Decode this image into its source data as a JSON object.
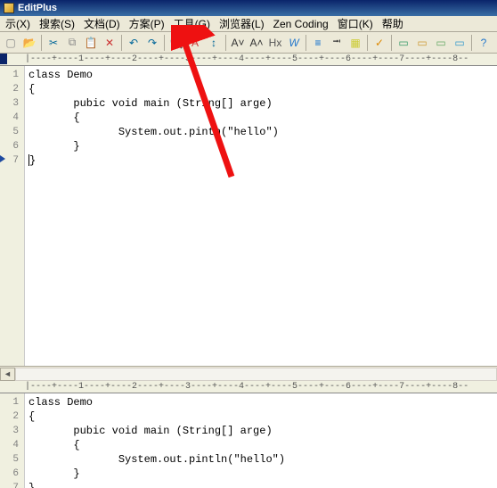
{
  "title": "EditPlus",
  "menubar": {
    "items": [
      "示(X)",
      "搜索(S)",
      "文档(D)",
      "方案(P)",
      "工具(G)",
      "浏览器(L)",
      "Zen Coding",
      "窗口(K)",
      "帮助"
    ]
  },
  "toolbar": {
    "buttons": [
      {
        "name": "new-icon",
        "glyph": "▢",
        "color": "#888"
      },
      {
        "name": "open-icon",
        "glyph": "📂",
        "color": "#c90"
      },
      {
        "sep": true
      },
      {
        "name": "cut-icon",
        "glyph": "✂",
        "color": "#069"
      },
      {
        "name": "copy-icon",
        "glyph": "⧉",
        "color": "#888"
      },
      {
        "name": "paste-icon",
        "glyph": "📋",
        "color": "#888"
      },
      {
        "name": "delete-icon",
        "glyph": "✕",
        "color": "#c33"
      },
      {
        "sep": true
      },
      {
        "name": "undo-icon",
        "glyph": "↶",
        "color": "#069"
      },
      {
        "name": "redo-icon",
        "glyph": "↷",
        "color": "#069"
      },
      {
        "sep": true
      },
      {
        "name": "search-icon",
        "glyph": "🔍",
        "color": "#555"
      },
      {
        "name": "fontcolor-a-icon",
        "glyph": "A",
        "color": "#c33"
      },
      {
        "name": "replace-icon",
        "glyph": "↕",
        "color": "#069"
      },
      {
        "sep": true
      },
      {
        "name": "zoomout-icon",
        "glyph": "A˅",
        "color": "#333"
      },
      {
        "name": "zoomin-icon",
        "glyph": "A˄",
        "color": "#333"
      },
      {
        "name": "hx-icon",
        "glyph": "Hx",
        "color": "#555"
      },
      {
        "name": "word-icon",
        "glyph": "W",
        "color": "#27c",
        "italic": true
      },
      {
        "sep": true
      },
      {
        "name": "wrap-icon",
        "glyph": "≡",
        "color": "#06c"
      },
      {
        "name": "tab-icon",
        "glyph": "⭲",
        "color": "#333"
      },
      {
        "name": "abcd-icon",
        "glyph": "▦",
        "color": "#cc3"
      },
      {
        "sep": true
      },
      {
        "name": "check-icon",
        "glyph": "✓",
        "color": "#d80"
      },
      {
        "sep": true
      },
      {
        "name": "win1-icon",
        "glyph": "▭",
        "color": "#396"
      },
      {
        "name": "win2-icon",
        "glyph": "▭",
        "color": "#c93"
      },
      {
        "name": "win3-icon",
        "glyph": "▭",
        "color": "#6a6"
      },
      {
        "name": "win4-icon",
        "glyph": "▭",
        "color": "#39c"
      },
      {
        "sep": true
      },
      {
        "name": "help-icon",
        "glyph": "?",
        "color": "#27c"
      }
    ]
  },
  "ruler_text": "|----+----1----+----2----+----3----+----4----+----5----+----6----+----7----+----8--",
  "top_editor": {
    "lines": [
      {
        "n": "1",
        "text": "class Demo"
      },
      {
        "n": "2",
        "text": "{"
      },
      {
        "n": "3",
        "text": "       pubic void main (String[] arge)"
      },
      {
        "n": "4",
        "text": "       {"
      },
      {
        "n": "5",
        "text": "              System.out.pint​n(\"hello\")"
      },
      {
        "n": "6",
        "text": "       }"
      },
      {
        "n": "7",
        "text": "}",
        "cursor": true,
        "marker": true
      }
    ]
  },
  "bottom_editor": {
    "lines": [
      {
        "n": "1",
        "text": "class Demo"
      },
      {
        "n": "2",
        "text": "{"
      },
      {
        "n": "3",
        "text": "       pubic void main (String[] arge)"
      },
      {
        "n": "4",
        "text": "       {"
      },
      {
        "n": "5",
        "text": "              System.out.pintln(\"hello\")"
      },
      {
        "n": "6",
        "text": "       }"
      },
      {
        "n": "7",
        "text": "}"
      }
    ]
  }
}
